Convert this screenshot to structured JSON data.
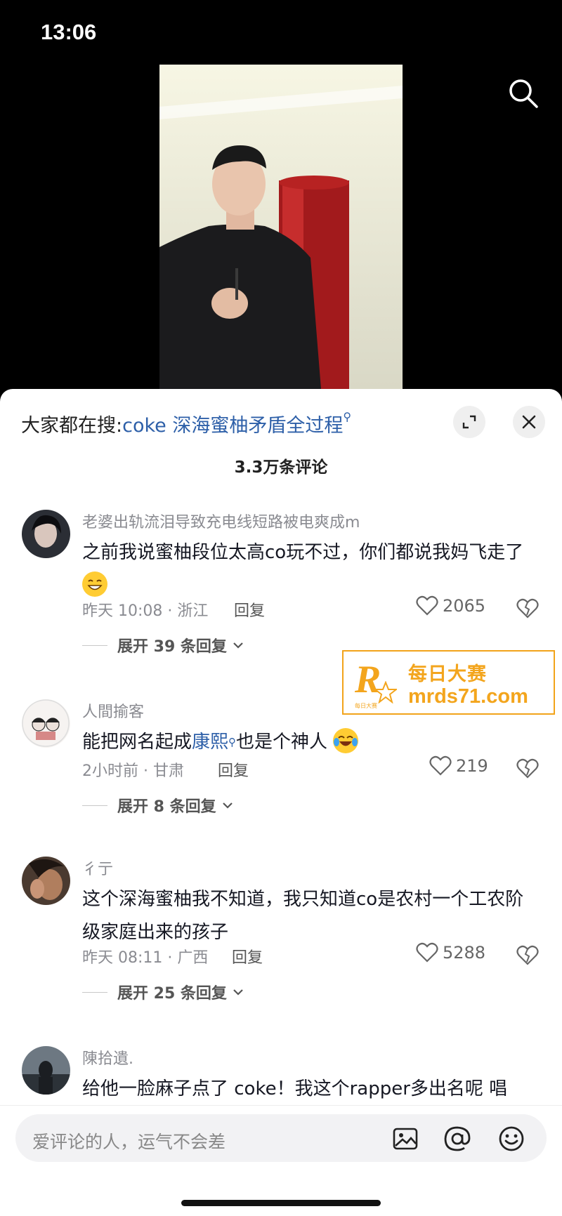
{
  "status_bar": {
    "time": "13:06"
  },
  "hot_search": {
    "prefix": "大家都在搜:",
    "keyword": "coke 深海蜜柚矛盾全过程",
    "search_glyph": "⚲"
  },
  "comment_count": "3.3万条评论",
  "comments": [
    {
      "username": "老婆出轨流泪导致充电线短路被电爽成m",
      "text": "之前我说蜜柚段位太高co玩不过，你们都说我妈飞走了",
      "emoji": "grinning-face-emoji",
      "time_location": "昨天 10:08 · 浙江",
      "reply_label": "回复",
      "likes": "2065",
      "expand_label": "展开 39 条回复"
    },
    {
      "username": "人間揄客",
      "text_before": "能把网名起成",
      "text_link": "康熙",
      "text_after": "也是个神人",
      "emoji": "tears-of-joy-emoji",
      "time_location": "2小时前 · 甘肃",
      "reply_label": "回复",
      "likes": "219",
      "expand_label": "展开 8 条回复"
    },
    {
      "username": "彳亍",
      "text": "这个深海蜜柚我不知道，我只知道co是农村一个工农阶级家庭出来的孩子",
      "time_location": "昨天 08:11 · 广西",
      "reply_label": "回复",
      "likes": "5288",
      "expand_label": "展开 25 条回复"
    },
    {
      "username": "陳拾遺.",
      "text": "给他一脸麻子点了 coke！我这个rapper多出名呢 唱"
    }
  ],
  "watermark": {
    "logo_letter": "R",
    "logo_small": "每日大赛",
    "title": "每日大赛",
    "url": "mrds71.com"
  },
  "input_bar": {
    "placeholder": "爱评论的人，运气不会差"
  },
  "colors": {
    "link": "#2d5fa8",
    "watermark": "#f3a51d",
    "panel": "#ffffff",
    "background": "#000000"
  }
}
